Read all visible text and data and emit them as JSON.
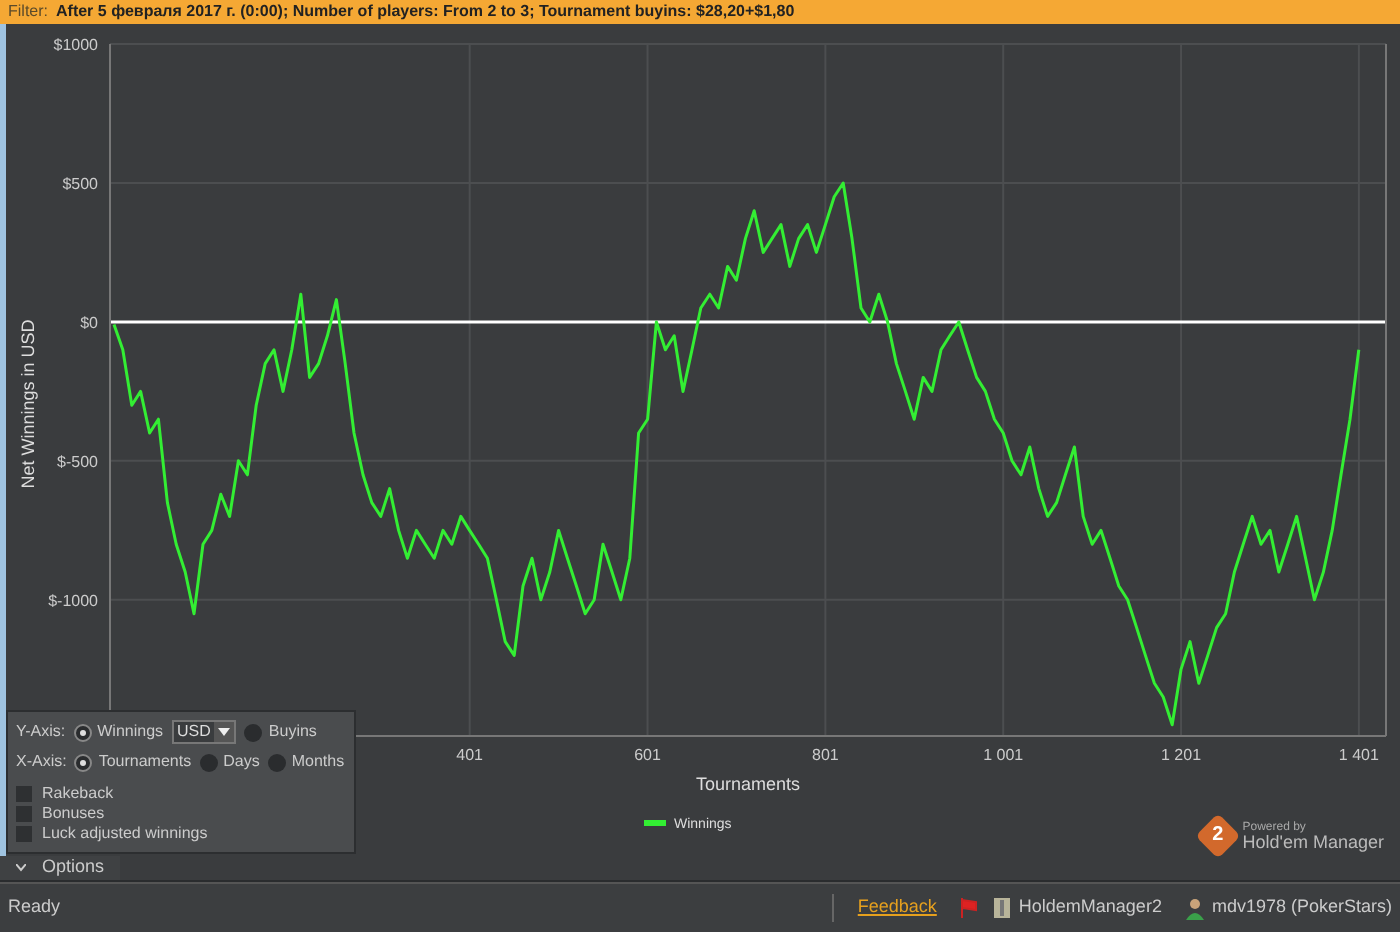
{
  "filter_bar": {
    "label": "Filter:",
    "text": "After 5 февраля 2017 г. (0:00); Number of players: From 2 to 3; Tournament buyins: $28,20+$1,80"
  },
  "chart": {
    "chart_data": {
      "type": "line",
      "xlabel": "Tournaments",
      "ylabel": "Net Winnings in USD",
      "x": [
        1,
        11,
        21,
        31,
        41,
        51,
        61,
        71,
        81,
        91,
        101,
        111,
        121,
        131,
        141,
        151,
        161,
        171,
        181,
        191,
        201,
        211,
        221,
        231,
        241,
        251,
        261,
        271,
        281,
        291,
        301,
        311,
        321,
        331,
        341,
        351,
        361,
        371,
        381,
        391,
        401,
        411,
        421,
        431,
        441,
        451,
        461,
        471,
        481,
        491,
        501,
        511,
        521,
        531,
        541,
        551,
        561,
        571,
        581,
        591,
        601,
        611,
        621,
        631,
        641,
        651,
        661,
        671,
        681,
        691,
        701,
        711,
        721,
        731,
        741,
        751,
        761,
        771,
        781,
        791,
        801,
        811,
        821,
        831,
        841,
        851,
        861,
        871,
        881,
        891,
        901,
        911,
        921,
        931,
        941,
        951,
        961,
        971,
        981,
        991,
        1001,
        1011,
        1021,
        1031,
        1041,
        1051,
        1061,
        1071,
        1081,
        1091,
        1101,
        1111,
        1121,
        1131,
        1141,
        1151,
        1161,
        1171,
        1181,
        1191,
        1201,
        1211,
        1221,
        1231,
        1241,
        1251,
        1261,
        1271,
        1281,
        1291,
        1301,
        1311,
        1321,
        1331,
        1341,
        1351,
        1361,
        1371,
        1381,
        1391,
        1401
      ],
      "series": [
        {
          "name": "Winnings",
          "color": "#33ee33",
          "values": [
            -10,
            -100,
            -300,
            -250,
            -400,
            -350,
            -650,
            -800,
            -900,
            -1050,
            -800,
            -750,
            -620,
            -700,
            -500,
            -550,
            -300,
            -150,
            -100,
            -250,
            -100,
            100,
            -200,
            -150,
            -50,
            80,
            -150,
            -400,
            -550,
            -650,
            -700,
            -600,
            -750,
            -850,
            -750,
            -800,
            -850,
            -750,
            -800,
            -700,
            -750,
            -800,
            -850,
            -1000,
            -1150,
            -1200,
            -950,
            -850,
            -1000,
            -900,
            -750,
            -850,
            -950,
            -1050,
            -1000,
            -800,
            -900,
            -1000,
            -850,
            -400,
            -350,
            0,
            -100,
            -50,
            -250,
            -100,
            50,
            100,
            50,
            200,
            150,
            300,
            400,
            250,
            300,
            350,
            200,
            300,
            350,
            250,
            350,
            450,
            500,
            300,
            50,
            0,
            100,
            0,
            -150,
            -250,
            -350,
            -200,
            -250,
            -100,
            -50,
            0,
            -100,
            -200,
            -250,
            -350,
            -400,
            -500,
            -550,
            -450,
            -600,
            -700,
            -650,
            -550,
            -450,
            -700,
            -800,
            -750,
            -850,
            -950,
            -1000,
            -1100,
            -1200,
            -1300,
            -1350,
            -1450,
            -1250,
            -1150,
            -1300,
            -1200,
            -1100,
            -1050,
            -900,
            -800,
            -700,
            -800,
            -750,
            -900,
            -800,
            -700,
            -850,
            -1000,
            -900,
            -750,
            -550,
            -350,
            -100
          ]
        }
      ],
      "grid": true,
      "xlim": [
        1,
        1427
      ],
      "ylim": [
        -1490,
        1000
      ],
      "xticks": [
        {
          "value": 401,
          "label": "401"
        },
        {
          "value": 601,
          "label": "601"
        },
        {
          "value": 801,
          "label": "801"
        },
        {
          "value": 1001,
          "label": "1 001"
        },
        {
          "value": 1201,
          "label": "1 201"
        },
        {
          "value": 1401,
          "label": "1 401"
        }
      ],
      "yticks": [
        {
          "value": -1000,
          "label": "$-1000"
        },
        {
          "value": -500,
          "label": "$-500"
        },
        {
          "value": 0,
          "label": "$0"
        },
        {
          "value": 500,
          "label": "$500"
        },
        {
          "value": 1000,
          "label": "$1000"
        }
      ]
    }
  },
  "options_panel": {
    "y_axis": {
      "label": "Y-Axis:",
      "options": [
        {
          "label": "Winnings",
          "selected": true
        },
        {
          "label": "Buyins",
          "selected": false
        }
      ],
      "currency": "USD"
    },
    "x_axis": {
      "label": "X-Axis:",
      "options": [
        {
          "label": "Tournaments",
          "selected": true
        },
        {
          "label": "Days",
          "selected": false
        },
        {
          "label": "Months",
          "selected": false
        }
      ]
    },
    "checkboxes": [
      {
        "label": "Rakeback",
        "checked": false
      },
      {
        "label": "Bonuses",
        "checked": false
      },
      {
        "label": "Luck adjusted winnings",
        "checked": false
      }
    ]
  },
  "options_toggle": {
    "label": "Options",
    "expanded": true
  },
  "branding": {
    "badge": "2",
    "powered_by": "Powered by",
    "name": "Hold'em Manager"
  },
  "status_bar": {
    "status": "Ready",
    "feedback": "Feedback",
    "app": "HoldemManager2",
    "user": "mdv1978 (PokerStars)"
  }
}
